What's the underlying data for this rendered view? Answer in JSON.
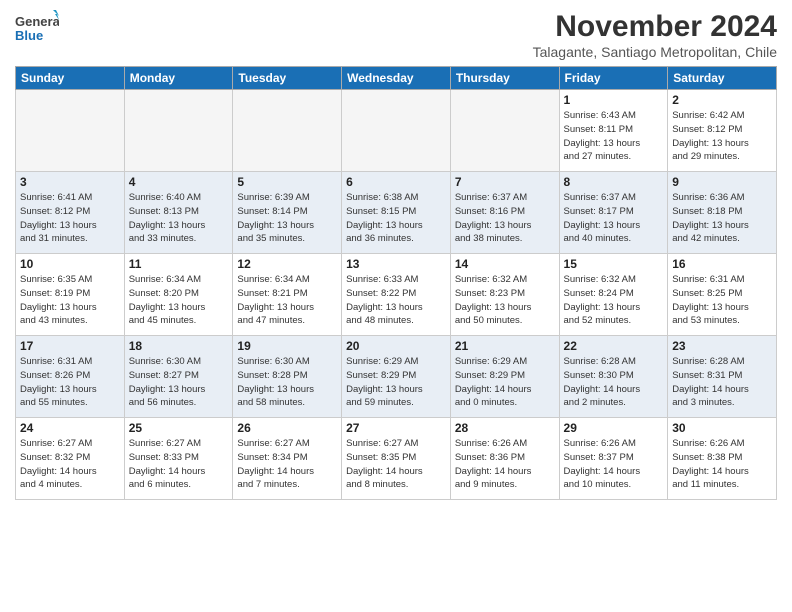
{
  "logo": {
    "line1": "General",
    "line2": "Blue"
  },
  "title": "November 2024",
  "location": "Talagante, Santiago Metropolitan, Chile",
  "days_of_week": [
    "Sunday",
    "Monday",
    "Tuesday",
    "Wednesday",
    "Thursday",
    "Friday",
    "Saturday"
  ],
  "weeks": [
    [
      {
        "day": "",
        "info": ""
      },
      {
        "day": "",
        "info": ""
      },
      {
        "day": "",
        "info": ""
      },
      {
        "day": "",
        "info": ""
      },
      {
        "day": "",
        "info": ""
      },
      {
        "day": "1",
        "info": "Sunrise: 6:43 AM\nSunset: 8:11 PM\nDaylight: 13 hours\nand 27 minutes."
      },
      {
        "day": "2",
        "info": "Sunrise: 6:42 AM\nSunset: 8:12 PM\nDaylight: 13 hours\nand 29 minutes."
      }
    ],
    [
      {
        "day": "3",
        "info": "Sunrise: 6:41 AM\nSunset: 8:12 PM\nDaylight: 13 hours\nand 31 minutes."
      },
      {
        "day": "4",
        "info": "Sunrise: 6:40 AM\nSunset: 8:13 PM\nDaylight: 13 hours\nand 33 minutes."
      },
      {
        "day": "5",
        "info": "Sunrise: 6:39 AM\nSunset: 8:14 PM\nDaylight: 13 hours\nand 35 minutes."
      },
      {
        "day": "6",
        "info": "Sunrise: 6:38 AM\nSunset: 8:15 PM\nDaylight: 13 hours\nand 36 minutes."
      },
      {
        "day": "7",
        "info": "Sunrise: 6:37 AM\nSunset: 8:16 PM\nDaylight: 13 hours\nand 38 minutes."
      },
      {
        "day": "8",
        "info": "Sunrise: 6:37 AM\nSunset: 8:17 PM\nDaylight: 13 hours\nand 40 minutes."
      },
      {
        "day": "9",
        "info": "Sunrise: 6:36 AM\nSunset: 8:18 PM\nDaylight: 13 hours\nand 42 minutes."
      }
    ],
    [
      {
        "day": "10",
        "info": "Sunrise: 6:35 AM\nSunset: 8:19 PM\nDaylight: 13 hours\nand 43 minutes."
      },
      {
        "day": "11",
        "info": "Sunrise: 6:34 AM\nSunset: 8:20 PM\nDaylight: 13 hours\nand 45 minutes."
      },
      {
        "day": "12",
        "info": "Sunrise: 6:34 AM\nSunset: 8:21 PM\nDaylight: 13 hours\nand 47 minutes."
      },
      {
        "day": "13",
        "info": "Sunrise: 6:33 AM\nSunset: 8:22 PM\nDaylight: 13 hours\nand 48 minutes."
      },
      {
        "day": "14",
        "info": "Sunrise: 6:32 AM\nSunset: 8:23 PM\nDaylight: 13 hours\nand 50 minutes."
      },
      {
        "day": "15",
        "info": "Sunrise: 6:32 AM\nSunset: 8:24 PM\nDaylight: 13 hours\nand 52 minutes."
      },
      {
        "day": "16",
        "info": "Sunrise: 6:31 AM\nSunset: 8:25 PM\nDaylight: 13 hours\nand 53 minutes."
      }
    ],
    [
      {
        "day": "17",
        "info": "Sunrise: 6:31 AM\nSunset: 8:26 PM\nDaylight: 13 hours\nand 55 minutes."
      },
      {
        "day": "18",
        "info": "Sunrise: 6:30 AM\nSunset: 8:27 PM\nDaylight: 13 hours\nand 56 minutes."
      },
      {
        "day": "19",
        "info": "Sunrise: 6:30 AM\nSunset: 8:28 PM\nDaylight: 13 hours\nand 58 minutes."
      },
      {
        "day": "20",
        "info": "Sunrise: 6:29 AM\nSunset: 8:29 PM\nDaylight: 13 hours\nand 59 minutes."
      },
      {
        "day": "21",
        "info": "Sunrise: 6:29 AM\nSunset: 8:29 PM\nDaylight: 14 hours\nand 0 minutes."
      },
      {
        "day": "22",
        "info": "Sunrise: 6:28 AM\nSunset: 8:30 PM\nDaylight: 14 hours\nand 2 minutes."
      },
      {
        "day": "23",
        "info": "Sunrise: 6:28 AM\nSunset: 8:31 PM\nDaylight: 14 hours\nand 3 minutes."
      }
    ],
    [
      {
        "day": "24",
        "info": "Sunrise: 6:27 AM\nSunset: 8:32 PM\nDaylight: 14 hours\nand 4 minutes."
      },
      {
        "day": "25",
        "info": "Sunrise: 6:27 AM\nSunset: 8:33 PM\nDaylight: 14 hours\nand 6 minutes."
      },
      {
        "day": "26",
        "info": "Sunrise: 6:27 AM\nSunset: 8:34 PM\nDaylight: 14 hours\nand 7 minutes."
      },
      {
        "day": "27",
        "info": "Sunrise: 6:27 AM\nSunset: 8:35 PM\nDaylight: 14 hours\nand 8 minutes."
      },
      {
        "day": "28",
        "info": "Sunrise: 6:26 AM\nSunset: 8:36 PM\nDaylight: 14 hours\nand 9 minutes."
      },
      {
        "day": "29",
        "info": "Sunrise: 6:26 AM\nSunset: 8:37 PM\nDaylight: 14 hours\nand 10 minutes."
      },
      {
        "day": "30",
        "info": "Sunrise: 6:26 AM\nSunset: 8:38 PM\nDaylight: 14 hours\nand 11 minutes."
      }
    ]
  ]
}
